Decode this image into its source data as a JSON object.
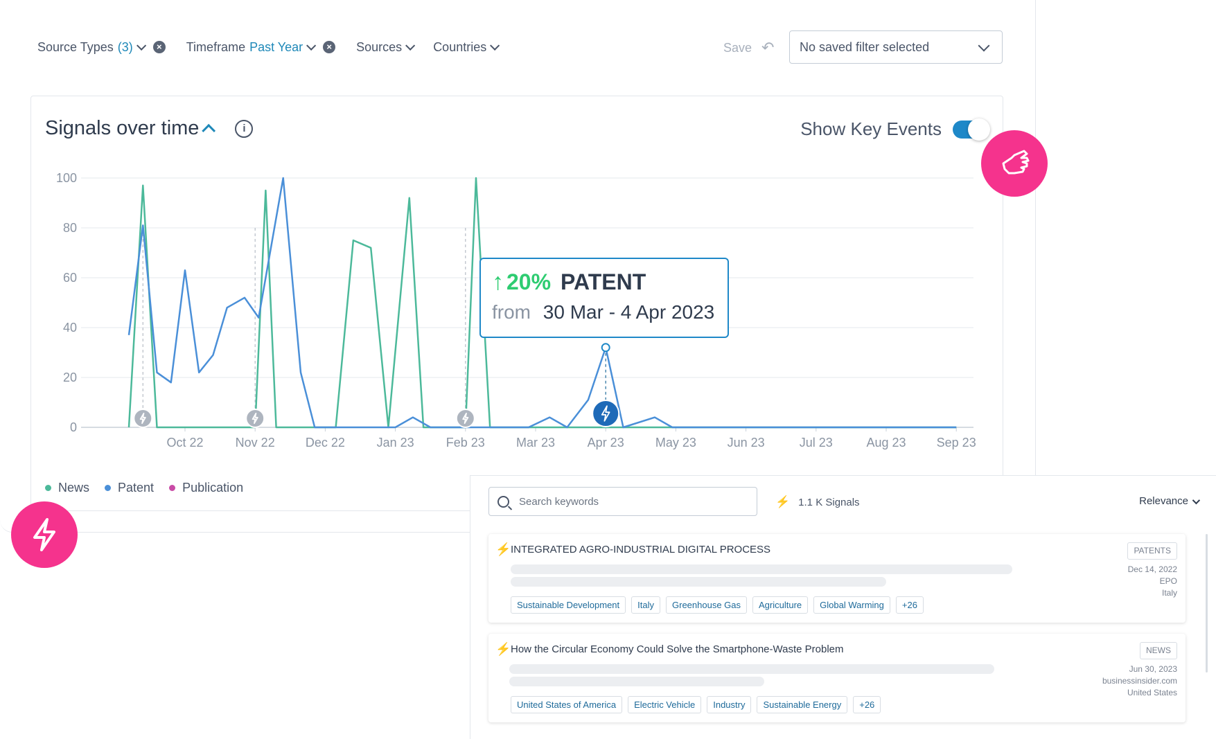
{
  "filters": {
    "source_types": {
      "label": "Source Types",
      "value": "(3)"
    },
    "timeframe": {
      "label": "Timeframe",
      "value": "Past Year"
    },
    "sources": {
      "label": "Sources"
    },
    "countries": {
      "label": "Countries"
    },
    "save_label": "Save",
    "saved_filter_value": "No saved filter selected"
  },
  "chart_header": {
    "title": "Signals over time",
    "toggle_label": "Show Key Events",
    "toggle_on": true
  },
  "tooltip": {
    "arrow": "↑",
    "percent": "20%",
    "type": "PATENT",
    "from_label": "from",
    "range": "30 Mar - 4 Apr 2023"
  },
  "chart_data": {
    "type": "line",
    "x_tick_labels": [
      "Oct 22",
      "Nov 22",
      "Dec 22",
      "Jan 23",
      "Feb 23",
      "Mar 23",
      "Apr 23",
      "May 23",
      "Jun 23",
      "Jul 23",
      "Aug 23",
      "Sep 23"
    ],
    "y_ticks": [
      0,
      20,
      40,
      60,
      80,
      100
    ],
    "ylim": [
      0,
      100
    ],
    "grid": true,
    "legend_placement": "bottom-left",
    "series": [
      {
        "name": "News",
        "color": "#4cb99a",
        "points": [
          [
            -0.8,
            0
          ],
          [
            -0.6,
            97
          ],
          [
            -0.4,
            0
          ],
          [
            0,
            0
          ],
          [
            0.5,
            0
          ],
          [
            1.0,
            0
          ],
          [
            1.15,
            95
          ],
          [
            1.3,
            0
          ],
          [
            1.7,
            0
          ],
          [
            2.15,
            0
          ],
          [
            2.4,
            75
          ],
          [
            2.65,
            72
          ],
          [
            2.9,
            0
          ],
          [
            3.2,
            92
          ],
          [
            3.4,
            0
          ],
          [
            4.0,
            0
          ],
          [
            4.15,
            100
          ],
          [
            4.35,
            0
          ],
          [
            11,
            0
          ]
        ]
      },
      {
        "name": "Patent",
        "color": "#4a8fd8",
        "points": [
          [
            -0.8,
            37
          ],
          [
            -0.6,
            81
          ],
          [
            -0.4,
            22
          ],
          [
            -0.2,
            18
          ],
          [
            0,
            63
          ],
          [
            0.2,
            22
          ],
          [
            0.4,
            29
          ],
          [
            0.6,
            48
          ],
          [
            0.85,
            52
          ],
          [
            1.05,
            44
          ],
          [
            1.4,
            100
          ],
          [
            1.65,
            22
          ],
          [
            1.85,
            0
          ],
          [
            2.6,
            0
          ],
          [
            3.0,
            0
          ],
          [
            3.25,
            4
          ],
          [
            3.5,
            0
          ],
          [
            4.9,
            0
          ],
          [
            5.2,
            4
          ],
          [
            5.45,
            0
          ],
          [
            5.75,
            11
          ],
          [
            6.0,
            32
          ],
          [
            6.25,
            0
          ],
          [
            6.7,
            4
          ],
          [
            6.95,
            0
          ],
          [
            11,
            0
          ]
        ]
      },
      {
        "name": "Publication",
        "color": "#c94ba6",
        "points": []
      }
    ],
    "key_events": [
      {
        "x": -0.6,
        "active": false
      },
      {
        "x": 1.0,
        "active": false
      },
      {
        "x": 4.0,
        "active": false
      },
      {
        "x": 6.0,
        "active": true
      }
    ]
  },
  "signals": {
    "search_placeholder": "Search keywords",
    "count": "1.1 K Signals",
    "sort": "Relevance",
    "items": [
      {
        "title": "INTEGRATED AGRO-INDUSTRIAL DIGITAL PROCESS",
        "badge": "PATENTS",
        "date": "Dec 14, 2022",
        "source": "EPO",
        "country": "Italy",
        "tags": [
          "Sustainable Development",
          "Italy",
          "Greenhouse Gas",
          "Agriculture",
          "Global Warming",
          "+26"
        ]
      },
      {
        "title": "How the Circular Economy Could Solve the Smartphone-Waste Problem",
        "badge": "NEWS",
        "date": "Jun 30, 2023",
        "source": "businessinsider.com",
        "country": "United States",
        "tags": [
          "United States of America",
          "Electric Vehicle",
          "Industry",
          "Sustainable Energy",
          "+26"
        ]
      }
    ]
  }
}
